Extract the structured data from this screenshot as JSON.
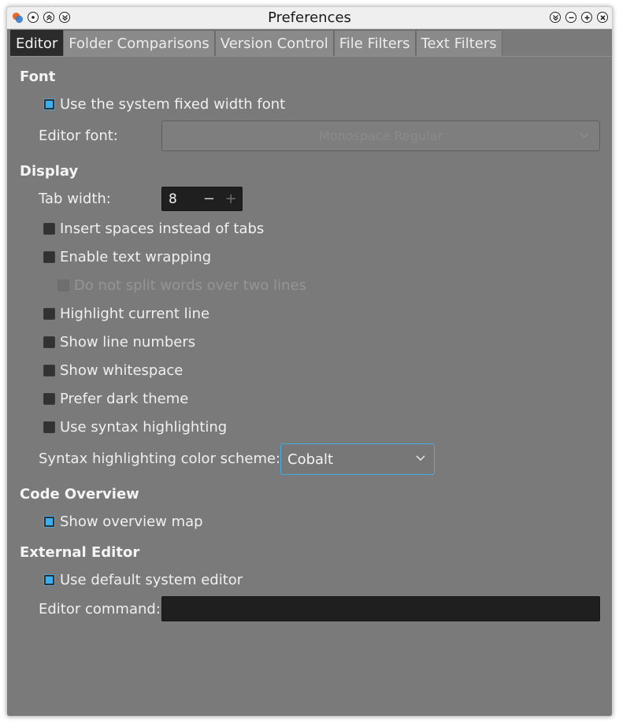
{
  "window": {
    "title": "Preferences",
    "title_buttons": [
      "menu",
      "keep-above",
      "shade",
      "minimize",
      "maximize",
      "close"
    ]
  },
  "tabs": [
    {
      "label": "Editor",
      "active": true
    },
    {
      "label": "Folder Comparisons",
      "active": false
    },
    {
      "label": "Version Control",
      "active": false
    },
    {
      "label": "File Filters",
      "active": false
    },
    {
      "label": "Text Filters",
      "active": false
    }
  ],
  "font": {
    "heading": "Font",
    "use_system_font": {
      "label": "Use the system fixed width font",
      "checked": true
    },
    "editor_font_label": "Editor font:",
    "editor_font_value": "Monospace Regular",
    "editor_font_disabled": true
  },
  "display": {
    "heading": "Display",
    "tab_width_label": "Tab width:",
    "tab_width_value": "8",
    "spin_minus": "−",
    "spin_plus": "+",
    "options": [
      {
        "label": "Insert spaces instead of tabs",
        "checked": false,
        "disabled": false
      },
      {
        "label": "Enable text wrapping",
        "checked": false,
        "disabled": false
      },
      {
        "label": "Do not split words over two lines",
        "checked": false,
        "disabled": true
      },
      {
        "label": "Highlight current line",
        "checked": false,
        "disabled": false
      },
      {
        "label": "Show line numbers",
        "checked": false,
        "disabled": false
      },
      {
        "label": "Show whitespace",
        "checked": false,
        "disabled": false
      },
      {
        "label": "Prefer dark theme",
        "checked": false,
        "disabled": false
      },
      {
        "label": "Use syntax highlighting",
        "checked": false,
        "disabled": false
      }
    ],
    "scheme_label": "Syntax highlighting color scheme:",
    "scheme_value": "Cobalt"
  },
  "code_overview": {
    "heading": "Code Overview",
    "show_map": {
      "label": "Show overview map",
      "checked": true
    }
  },
  "external_editor": {
    "heading": "External Editor",
    "use_default": {
      "label": "Use default system editor",
      "checked": true
    },
    "command_label": "Editor command:",
    "command_value": ""
  },
  "colors": {
    "panel": "#7a7a7a",
    "accent": "#3daee9",
    "active_tab": "#2b2b2b",
    "field_bg": "#1f1f1f"
  }
}
